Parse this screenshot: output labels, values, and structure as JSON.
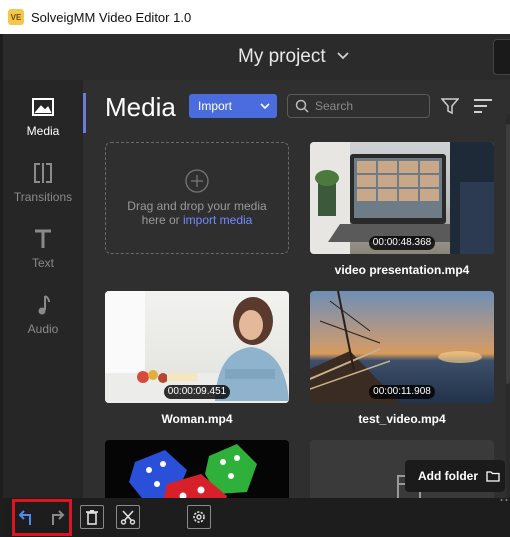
{
  "window": {
    "title": "SolveigMM Video Editor 1.0",
    "logo_text": "VE"
  },
  "project": {
    "title": "My project"
  },
  "sidebar": {
    "items": [
      {
        "label": "Media",
        "icon": "image-icon",
        "active": true
      },
      {
        "label": "Transitions",
        "icon": "transitions-icon",
        "active": false
      },
      {
        "label": "Text",
        "icon": "text-icon",
        "active": false
      },
      {
        "label": "Audio",
        "icon": "music-note-icon",
        "active": false
      }
    ]
  },
  "media": {
    "title": "Media",
    "import_label": "Import",
    "search_placeholder": "Search",
    "drop_zone": {
      "text_line1": "Drag and drop your media",
      "text_line2_prefix": "here or ",
      "link_text": "import media"
    },
    "clips": [
      {
        "name": "video presentation.mp4",
        "duration": "00:00:48.368"
      },
      {
        "name": "Woman.mp4",
        "duration": "00:00:09.451"
      },
      {
        "name": "test_video.mp4",
        "duration": "00:00:11.908"
      }
    ],
    "add_folder_label": "Add folder"
  },
  "toolbar": {
    "buttons": [
      "undo-icon",
      "redo-icon",
      "trash-icon",
      "cut-icon",
      "settings-icon"
    ]
  },
  "colors": {
    "accent": "#4a6cdf",
    "link": "#6f8cff",
    "highlight_box": "#e0141e"
  }
}
